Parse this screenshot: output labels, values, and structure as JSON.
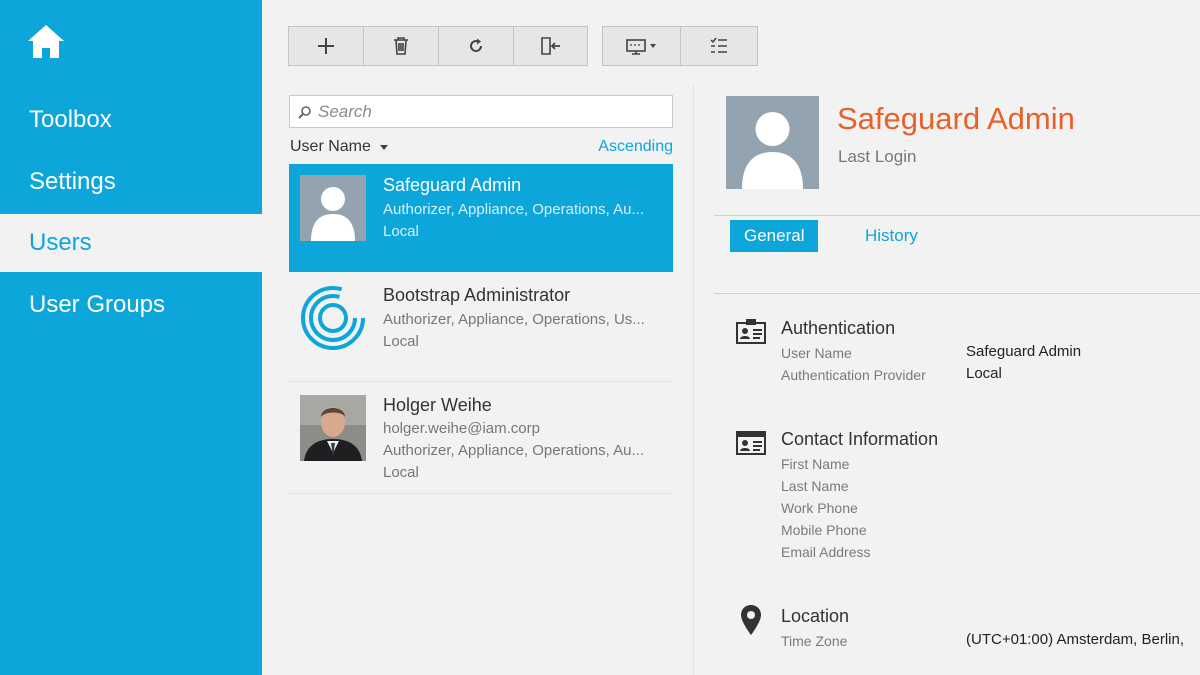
{
  "sidebar": {
    "items": [
      {
        "label": "Toolbox"
      },
      {
        "label": "Settings"
      },
      {
        "label": "Users"
      },
      {
        "label": "User Groups"
      }
    ]
  },
  "search": {
    "placeholder": "Search"
  },
  "sort": {
    "field": "User Name",
    "order": "Ascending"
  },
  "users": [
    {
      "name": "Safeguard Admin",
      "lines": [
        "Authorizer, Appliance, Operations, Au...",
        "Local"
      ]
    },
    {
      "name": "Bootstrap Administrator",
      "lines": [
        "Authorizer, Appliance, Operations, Us...",
        "Local"
      ]
    },
    {
      "name": "Holger Weihe",
      "lines": [
        "holger.weihe@iam.corp",
        "Authorizer, Appliance, Operations, Au...",
        "Local"
      ]
    }
  ],
  "detail": {
    "name": "Safeguard Admin",
    "subtitle": "Last Login",
    "tabs": [
      "General",
      "History"
    ],
    "authentication": {
      "title": "Authentication",
      "fields": [
        {
          "label": "User Name",
          "value": "Safeguard Admin"
        },
        {
          "label": "Authentication Provider",
          "value": "Local"
        }
      ]
    },
    "contact": {
      "title": "Contact Information",
      "fields": [
        {
          "label": "First Name"
        },
        {
          "label": "Last Name"
        },
        {
          "label": "Work Phone"
        },
        {
          "label": "Mobile Phone"
        },
        {
          "label": "Email Address"
        }
      ]
    },
    "location": {
      "title": "Location",
      "fields": [
        {
          "label": "Time Zone",
          "value": "(UTC+01:00) Amsterdam, Berlin,"
        }
      ]
    }
  },
  "colors": {
    "accent": "#0ca6da",
    "name_highlight": "#e9612a",
    "background": "#f2f2f2"
  }
}
